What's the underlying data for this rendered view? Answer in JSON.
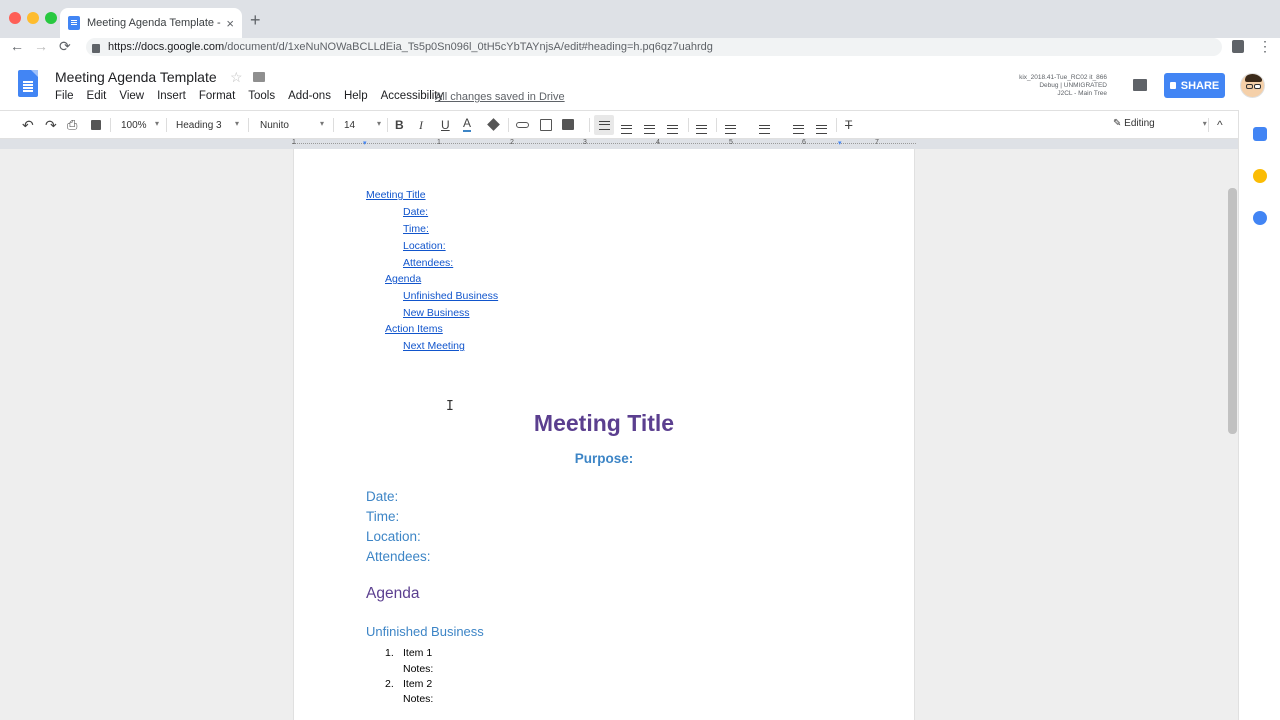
{
  "browser": {
    "tab_title": "Meeting Agenda Template - Go",
    "tab_close": "×",
    "new_tab": "+",
    "url_host": "https://docs.google.com",
    "url_path": "/document/d/1xeNuNOWaBCLLdEia_Ts5p0Sn096l_0tH5cYbTAYnjsA/edit#heading=h.pq6qz7uahrdg",
    "back": "←",
    "forward": "→",
    "reload": "⟳",
    "menu": "⋮"
  },
  "header": {
    "doc_title": "Meeting Agenda Template",
    "star": "☆",
    "menu": [
      "File",
      "Edit",
      "View",
      "Insert",
      "Format",
      "Tools",
      "Add-ons",
      "Help",
      "Accessibility"
    ],
    "saved_status": "All changes saved in Drive",
    "debug_lines": [
      "kix_2018.41-Tue_RC02 it_866",
      "Debug | UNMIGRATED",
      "J2CL - Main Tree"
    ],
    "share_label": "SHARE"
  },
  "toolbar": {
    "undo": "↶",
    "redo": "↷",
    "print": "⎙",
    "zoom": "100%",
    "style": "Heading 3",
    "font": "Nunito",
    "size": "14",
    "bold": "B",
    "italic": "I",
    "underline": "U",
    "text_color": "A",
    "editing_mode": "Editing",
    "collapse": "^"
  },
  "ruler": {
    "numbers": [
      "1",
      "1",
      "2",
      "3",
      "4",
      "5",
      "6",
      "7"
    ]
  },
  "toc": [
    {
      "label": "Meeting Title",
      "level": 1
    },
    {
      "label": "Date:",
      "level": 3
    },
    {
      "label": "Time:",
      "level": 3
    },
    {
      "label": "Location:",
      "level": 3
    },
    {
      "label": "Attendees:",
      "level": 3
    },
    {
      "label": "Agenda",
      "level": 2
    },
    {
      "label": "Unfinished Business",
      "level": 3
    },
    {
      "label": "New Business",
      "level": 3
    },
    {
      "label": "Action Items",
      "level": 2
    },
    {
      "label": "Next Meeting",
      "level": 3
    }
  ],
  "document": {
    "title": "Meeting Title",
    "purpose": "Purpose:",
    "fields": [
      "Date:",
      "Time:",
      "Location:",
      "Attendees:"
    ],
    "agenda_heading": "Agenda",
    "unfinished_heading": "Unfinished Business",
    "items": [
      {
        "num": "1.",
        "text": "Item 1",
        "notes": "Notes:"
      },
      {
        "num": "2.",
        "text": "Item 2",
        "notes": "Notes:"
      }
    ]
  },
  "colors": {
    "title_purple": "#5b3f8f",
    "heading_blue": "#3d85c6",
    "link_blue": "#1155cc",
    "share_blue": "#4285f4"
  }
}
